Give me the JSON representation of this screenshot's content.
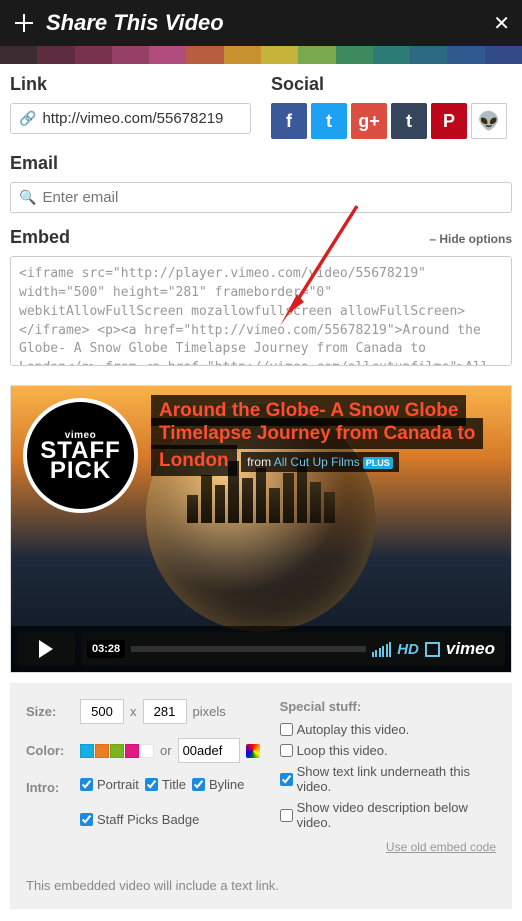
{
  "header": {
    "title": "Share This Video"
  },
  "color_bar": [
    "#3a2c31",
    "#5d2d3f",
    "#78324b",
    "#954064",
    "#b14c7f",
    "#b95d41",
    "#c7922f",
    "#c6b339",
    "#7aa84f",
    "#3c8a5d",
    "#2d7b77",
    "#2c6a84",
    "#2e5a8f",
    "#334b89"
  ],
  "link": {
    "label": "Link",
    "url": "http://vimeo.com/55678219"
  },
  "social": {
    "label": "Social",
    "items": [
      {
        "name": "facebook",
        "glyph": "f",
        "cls": "fb"
      },
      {
        "name": "twitter",
        "glyph": "t",
        "cls": "tw"
      },
      {
        "name": "googleplus",
        "glyph": "g+",
        "cls": "gp"
      },
      {
        "name": "tumblr",
        "glyph": "t",
        "cls": "tb"
      },
      {
        "name": "pinterest",
        "glyph": "P",
        "cls": "pn"
      },
      {
        "name": "reddit",
        "glyph": "👽",
        "cls": "rd"
      }
    ]
  },
  "email": {
    "label": "Email",
    "placeholder": "Enter email"
  },
  "embed": {
    "label": "Embed",
    "hide_options": "– Hide options",
    "code": "<iframe src=\"http://player.vimeo.com/video/55678219\" width=\"500\" height=\"281\" frameborder=\"0\" webkitAllowFullScreen mozallowfullscreen allowFullScreen></iframe> <p><a href=\"http://vimeo.com/55678219\">Around the Globe- A Snow Globe Timelapse Journey from Canada to London</a> from <a href=\"http://vimeo.com/allcutupfilms\">All Cut Up Films</a> on <a"
  },
  "video": {
    "title": "Around the Globe- A Snow Globe Timelapse Journey from Canada to London",
    "from_prefix": "from ",
    "author": "All Cut Up Films",
    "badge": "PLUS",
    "staff_pick": {
      "v": "vimeo",
      "l1": "STAFF",
      "l2": "PICK"
    },
    "duration": "03:28",
    "hd": "HD",
    "logo": "vimeo"
  },
  "options": {
    "size": {
      "label": "Size:",
      "w": "500",
      "h": "281",
      "suffix": "pixels",
      "x": "x"
    },
    "color": {
      "label": "Color:",
      "swatches": [
        "#17aee5",
        "#f07c22",
        "#7ab51d",
        "#e21b84",
        "#ffffff"
      ],
      "or": "or",
      "hex": "00adef"
    },
    "intro": {
      "label": "Intro:",
      "portrait": {
        "label": "Portrait",
        "checked": true
      },
      "title": {
        "label": "Title",
        "checked": true
      },
      "byline": {
        "label": "Byline",
        "checked": true
      },
      "staff": {
        "label": "Staff Picks Badge",
        "checked": true
      }
    },
    "special": {
      "label": "Special stuff:",
      "autoplay": {
        "label": "Autoplay this video.",
        "checked": false
      },
      "loop": {
        "label": "Loop this video.",
        "checked": false
      },
      "textlink": {
        "label": "Show text link underneath this video.",
        "checked": true
      },
      "desc": {
        "label": "Show video description below video.",
        "checked": false
      }
    },
    "use_old": "Use old embed code",
    "footer": "This embedded video will include a text link."
  }
}
